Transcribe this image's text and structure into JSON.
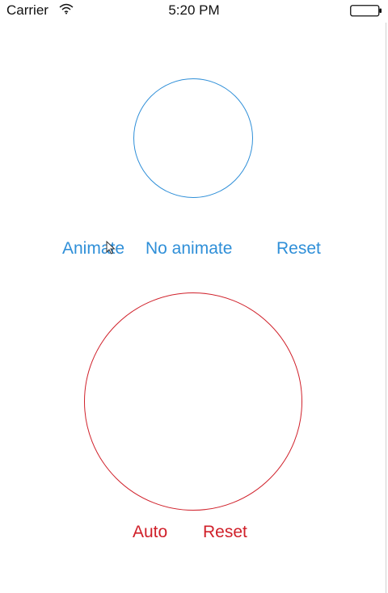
{
  "status_bar": {
    "carrier": "Carrier",
    "time": "5:20 PM",
    "icons": [
      "wifi-icon",
      "battery-icon"
    ]
  },
  "top_section": {
    "accent_color": "#2f8fd8",
    "buttons": {
      "animate": "Animate",
      "no_animate": "No animate",
      "reset": "Reset"
    }
  },
  "bottom_section": {
    "accent_color": "#d0202a",
    "buttons": {
      "auto": "Auto",
      "reset": "Reset"
    }
  }
}
